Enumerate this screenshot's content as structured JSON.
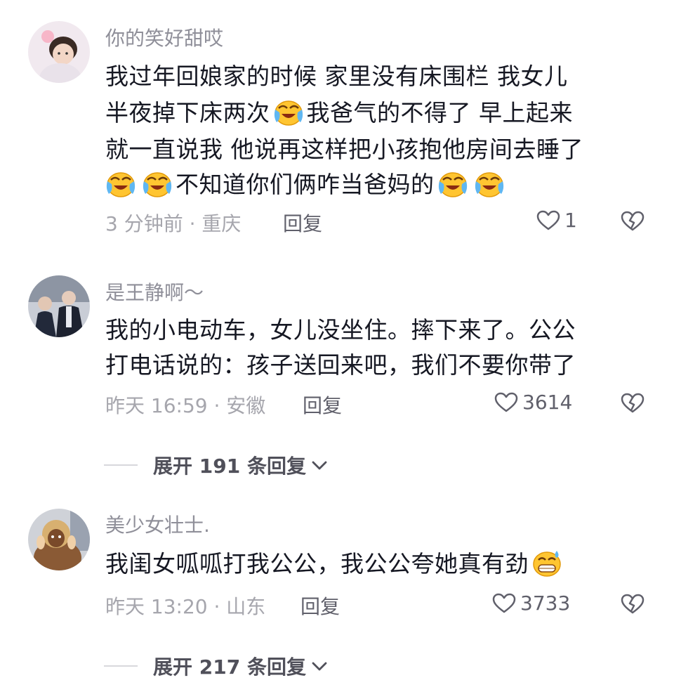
{
  "comments": [
    {
      "username": "你的笑好甜哎",
      "lines": [
        [
          "我过年回娘家的时候  家里没有床围栏  我女儿"
        ],
        [
          "半夜掉下床两次",
          "我爸气的不得了  早上起来"
        ],
        [
          "就一直说我  他说再这样把小孩抱他房间去睡了"
        ],
        [
          "",
          "",
          "不知道你们俩咋当爸妈的"
        ]
      ],
      "time_location": "3 分钟前 · 重庆",
      "reply_label": "回复",
      "likes": "1",
      "emoji_names": [
        "crying-laughing-emoji"
      ]
    },
    {
      "username": "是王静啊～",
      "lines": [
        [
          "我的小电动车，女儿没坐住。摔下来了。公公"
        ],
        [
          "打电话说的：孩子送回来吧，我们不要你带了"
        ]
      ],
      "time_location": "昨天 16:59 · 安徽",
      "reply_label": "回复",
      "likes": "3614",
      "expand_label": "展开 191 条回复"
    },
    {
      "username": "美少女壮士.",
      "lines": [
        [
          "我闺女呱呱打我公公，我公公夸她真有劲"
        ]
      ],
      "time_location": "昨天 13:20 · 山东",
      "reply_label": "回复",
      "likes": "3733",
      "expand_label": "展开 217 条回复",
      "emoji_names": [
        "sweat-grin-emoji"
      ]
    }
  ],
  "icons": {
    "like": "heart-outline-icon",
    "dislike": "broken-heart-icon",
    "chevron": "chevron-down-icon"
  },
  "colors": {
    "text": "#161823",
    "username": "#8f8f99",
    "meta": "#a6a6ad",
    "action": "#60606b"
  }
}
